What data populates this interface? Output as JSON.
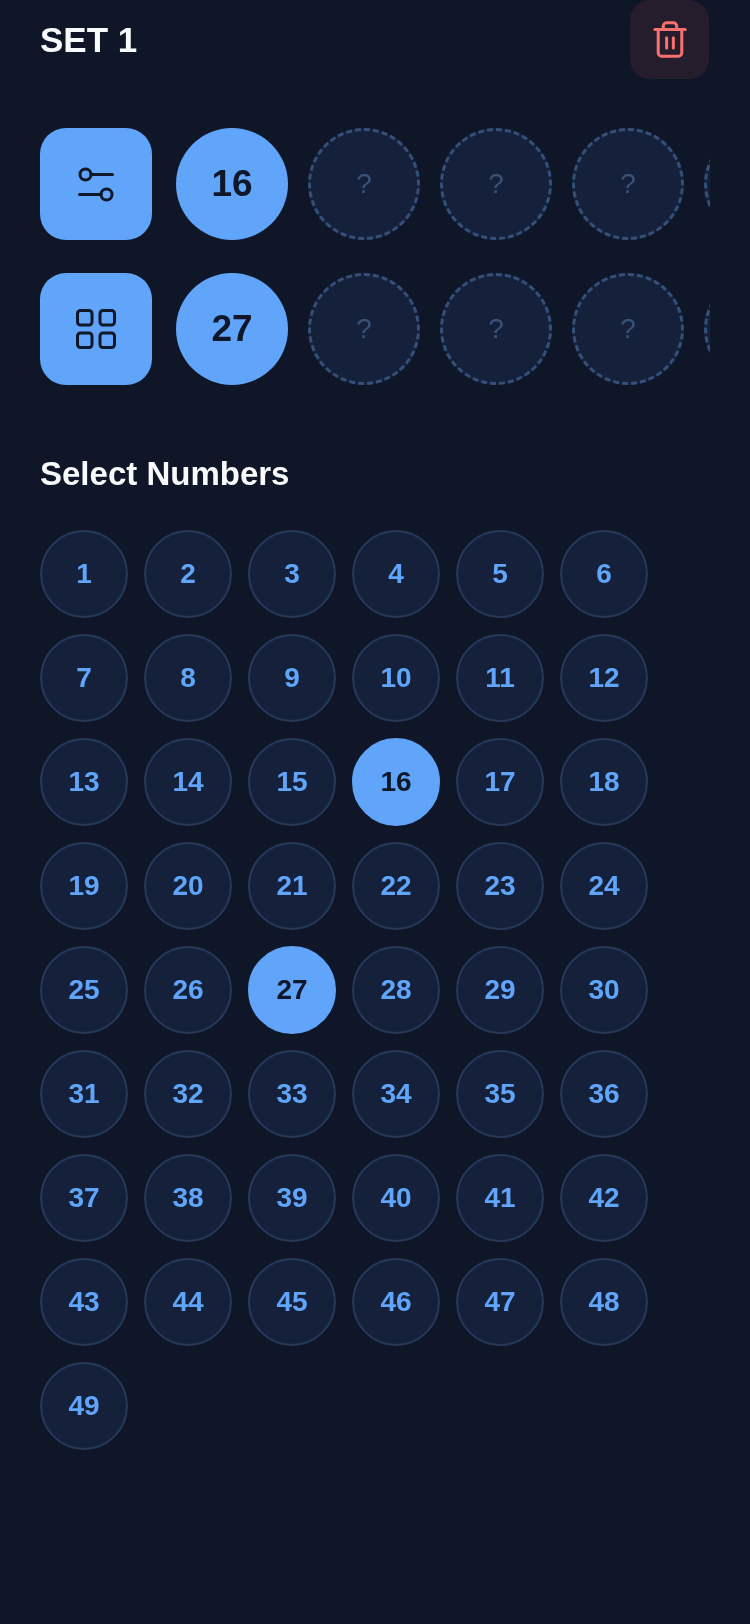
{
  "header": {
    "title": "SET 1"
  },
  "rows": [
    {
      "kind": "sliders",
      "slots": [
        {
          "label": "16",
          "filled": true
        },
        {
          "label": "?",
          "filled": false
        },
        {
          "label": "?",
          "filled": false
        },
        {
          "label": "?",
          "filled": false
        },
        {
          "filled": false
        }
      ]
    },
    {
      "kind": "grid",
      "slots": [
        {
          "label": "27",
          "filled": true
        },
        {
          "label": "?",
          "filled": false
        },
        {
          "label": "?",
          "filled": false
        },
        {
          "label": "?",
          "filled": false
        },
        {
          "filled": false
        }
      ]
    }
  ],
  "numbers_section": {
    "title": "Select Numbers",
    "numbers": [
      {
        "label": "1",
        "selected": false
      },
      {
        "label": "2",
        "selected": false
      },
      {
        "label": "3",
        "selected": false
      },
      {
        "label": "4",
        "selected": false
      },
      {
        "label": "5",
        "selected": false
      },
      {
        "label": "6",
        "selected": false
      },
      {
        "label": "7",
        "selected": false
      },
      {
        "label": "8",
        "selected": false
      },
      {
        "label": "9",
        "selected": false
      },
      {
        "label": "10",
        "selected": false
      },
      {
        "label": "11",
        "selected": false
      },
      {
        "label": "12",
        "selected": false
      },
      {
        "label": "13",
        "selected": false
      },
      {
        "label": "14",
        "selected": false
      },
      {
        "label": "15",
        "selected": false
      },
      {
        "label": "16",
        "selected": true
      },
      {
        "label": "17",
        "selected": false
      },
      {
        "label": "18",
        "selected": false
      },
      {
        "label": "19",
        "selected": false
      },
      {
        "label": "20",
        "selected": false
      },
      {
        "label": "21",
        "selected": false
      },
      {
        "label": "22",
        "selected": false
      },
      {
        "label": "23",
        "selected": false
      },
      {
        "label": "24",
        "selected": false
      },
      {
        "label": "25",
        "selected": false
      },
      {
        "label": "26",
        "selected": false
      },
      {
        "label": "27",
        "selected": true
      },
      {
        "label": "28",
        "selected": false
      },
      {
        "label": "29",
        "selected": false
      },
      {
        "label": "30",
        "selected": false
      },
      {
        "label": "31",
        "selected": false
      },
      {
        "label": "32",
        "selected": false
      },
      {
        "label": "33",
        "selected": false
      },
      {
        "label": "34",
        "selected": false
      },
      {
        "label": "35",
        "selected": false
      },
      {
        "label": "36",
        "selected": false
      },
      {
        "label": "37",
        "selected": false
      },
      {
        "label": "38",
        "selected": false
      },
      {
        "label": "39",
        "selected": false
      },
      {
        "label": "40",
        "selected": false
      },
      {
        "label": "41",
        "selected": false
      },
      {
        "label": "42",
        "selected": false
      },
      {
        "label": "43",
        "selected": false
      },
      {
        "label": "44",
        "selected": false
      },
      {
        "label": "45",
        "selected": false
      },
      {
        "label": "46",
        "selected": false
      },
      {
        "label": "47",
        "selected": false
      },
      {
        "label": "48",
        "selected": false
      },
      {
        "label": "49",
        "selected": false
      }
    ]
  }
}
